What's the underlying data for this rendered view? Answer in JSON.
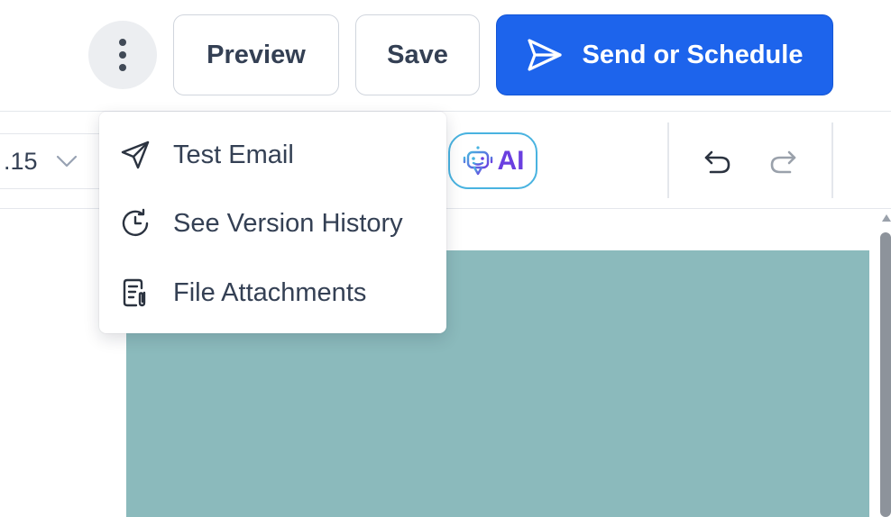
{
  "header": {
    "more_icon": "kebab-vertical-icon",
    "preview_label": "Preview",
    "save_label": "Save",
    "send_label": "Send or Schedule",
    "send_icon": "paper-plane-icon",
    "primary_color": "#1d64ec"
  },
  "toolbar": {
    "line_height_value": ".15",
    "ai_label": "AI",
    "ai_icon": "robot-icon",
    "ai_border_color": "#49b3e0",
    "ai_text_color": "#6a3fe0",
    "undo_icon": "undo-icon",
    "redo_icon": "redo-icon"
  },
  "menu": {
    "items": [
      {
        "label": "Test Email",
        "icon": "paper-plane-icon"
      },
      {
        "label": "See Version History",
        "icon": "history-clock-icon"
      },
      {
        "label": "File Attachments",
        "icon": "file-attachment-icon"
      }
    ]
  },
  "canvas": {
    "block_color": "#8bbabc"
  }
}
